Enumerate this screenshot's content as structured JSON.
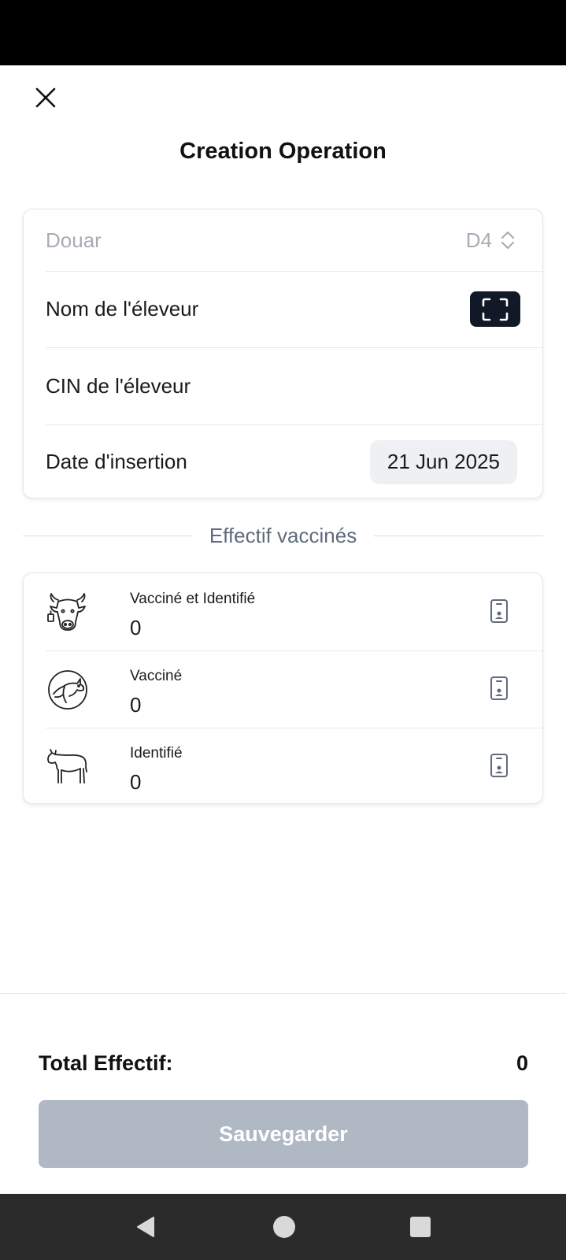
{
  "header": {
    "title": "Creation Operation",
    "close_icon": "close-icon"
  },
  "form": {
    "douar_placeholder": "Douar",
    "douar_value": "D4",
    "nom_label": "Nom de l'éleveur",
    "cin_label": "CIN de l'éleveur",
    "date_label": "Date d'insertion",
    "date_value": "21 Jun 2025"
  },
  "section": {
    "title": "Effectif vaccinés"
  },
  "effectif": [
    {
      "title": "Vacciné et Identifié",
      "count": "0",
      "icon": "tagged-cow-icon"
    },
    {
      "title": "Vacciné",
      "count": "0",
      "icon": "cow-circle-icon"
    },
    {
      "title": "Identifié",
      "count": "0",
      "icon": "calf-icon"
    }
  ],
  "footer": {
    "total_label": "Total Effectif:",
    "total_value": "0",
    "save_label": "Sauvegarder"
  },
  "colors": {
    "primary_dark": "#111827",
    "disabled_button": "#b0b8c4",
    "chip_bg": "#eef0f3",
    "section_text": "#5e6b7d"
  }
}
